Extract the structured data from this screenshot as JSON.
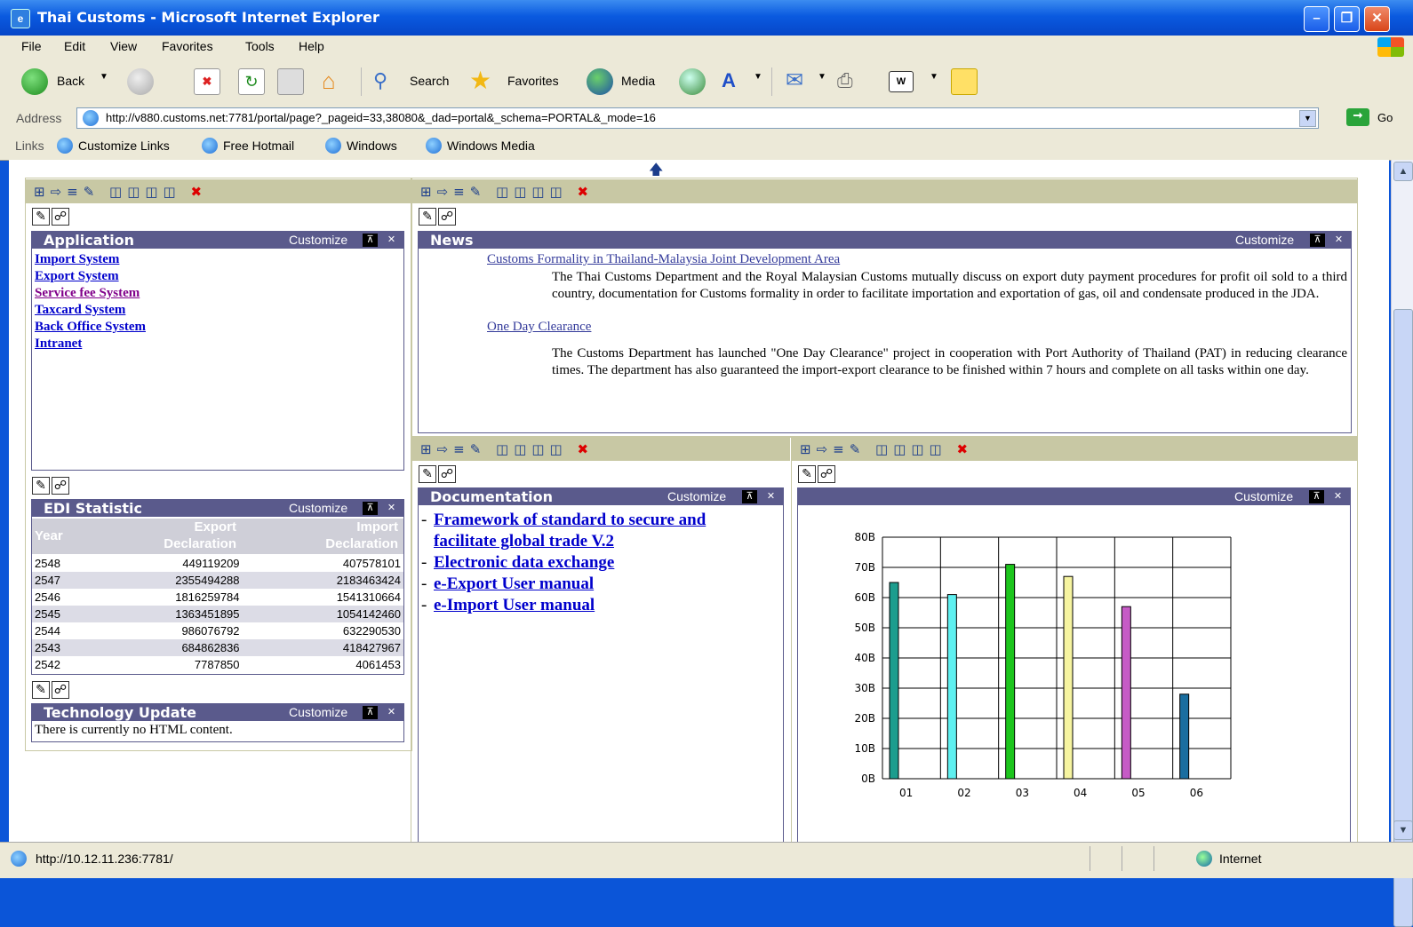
{
  "window": {
    "title": "Thai Customs - Microsoft Internet Explorer"
  },
  "menu": [
    "File",
    "Edit",
    "View",
    "Favorites",
    "Tools",
    "Help"
  ],
  "toolbar": {
    "back": "Back",
    "search": "Search",
    "favorites": "Favorites",
    "media": "Media"
  },
  "address": {
    "label": "Address",
    "url": "http://v880.customs.net:7781/portal/page?_pageid=33,38080&_dad=portal&_schema=PORTAL&_mode=16",
    "go": "Go"
  },
  "links": {
    "label": "Links",
    "items": [
      "Customize Links",
      "Free Hotmail",
      "Windows",
      "Windows Media"
    ]
  },
  "status": {
    "url": "http://10.12.11.236:7781/",
    "zone": "Internet"
  },
  "portlets": {
    "customize": "Customize",
    "application": {
      "title": "Application",
      "links": [
        "Import System",
        "Export System",
        "Service fee System",
        "Taxcard System",
        "Back Office System",
        "Intranet"
      ]
    },
    "news": {
      "title": "News",
      "items": [
        {
          "headline": "Customs Formality in Thailand-Malaysia Joint Development Area",
          "body": "The Thai Customs Department and the Royal Malaysian Customs mutually discuss on export duty payment procedures for profit oil sold to a third country, documentation for Customs formality in order to facilitate importation and exportation of gas, oil and condensate produced in the JDA."
        },
        {
          "headline": "One Day Clearance",
          "body": "The Customs Department has launched \"One Day Clearance\" project in cooperation with Port Authority of Thailand (PAT) in reducing clearance times. The department has also guaranteed the import-export clearance to be finished within 7 hours and complete on all tasks within one day."
        }
      ]
    },
    "edi": {
      "title": "EDI Statistic",
      "headers": [
        "Year",
        "Export Declaration",
        "Import Declaration"
      ],
      "rows": [
        [
          "2548",
          "449119209",
          "407578101"
        ],
        [
          "2547",
          "2355494288",
          "2183463424"
        ],
        [
          "2546",
          "1816259784",
          "1541310664"
        ],
        [
          "2545",
          "1363451895",
          "1054142460"
        ],
        [
          "2544",
          "986076792",
          "632290530"
        ],
        [
          "2543",
          "684862836",
          "418427967"
        ],
        [
          "2542",
          "7787850",
          "4061453"
        ]
      ]
    },
    "documentation": {
      "title": "Documentation",
      "links": [
        "Framework of standard to secure and facilitate global trade V.2",
        "Electronic data exchange",
        "e-Export User manual",
        "e-Import User manual"
      ]
    },
    "technology": {
      "title": "Technology Update",
      "body": "There is currently no HTML content."
    }
  },
  "chart_data": {
    "type": "bar",
    "categories": [
      "01",
      "02",
      "03",
      "04",
      "05",
      "06"
    ],
    "values": [
      65,
      61,
      71,
      67,
      57,
      28
    ],
    "colors": [
      "#1c9d8e",
      "#5ef0f0",
      "#1dc51d",
      "#f6f4a0",
      "#c65bc6",
      "#1a6ea0"
    ],
    "ytick_labels": [
      "0B",
      "10B",
      "20B",
      "30B",
      "40B",
      "50B",
      "60B",
      "70B",
      "80B"
    ],
    "ylim": [
      0,
      80
    ],
    "grid": true
  }
}
